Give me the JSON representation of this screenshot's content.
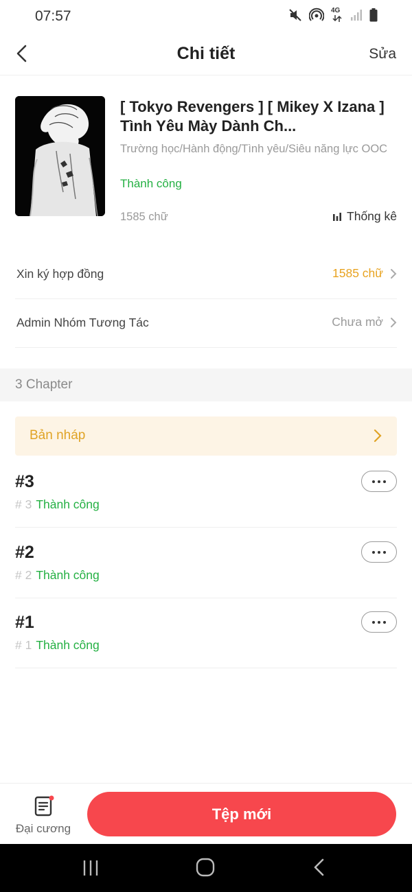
{
  "status_bar": {
    "time": "07:57",
    "icons": [
      "mute-icon",
      "hotspot-icon",
      "network-4g-icon",
      "signal-icon",
      "battery-icon"
    ],
    "network_label": "4G"
  },
  "nav": {
    "title": "Chi tiết",
    "edit_label": "Sửa",
    "back_icon": "chevron-left-icon"
  },
  "book": {
    "title": "[ Tokyo Revengers ] [ Mikey X Izana ] Tình Yêu Mày Dành Ch...",
    "genre": "Trường học/Hành động/Tình yêu/Siêu năng lực OOC",
    "status": "Thành công",
    "word_count": "1585 chữ",
    "stats_label": "Thống kê"
  },
  "rows": [
    {
      "label": "Xin ký hợp đồng",
      "value": "1585 chữ",
      "value_color": "#e8a320"
    },
    {
      "label": "Admin Nhóm Tương Tác",
      "value": "Chưa mở",
      "value_color": "#9a9a9a"
    }
  ],
  "chapter_section": {
    "label": "3 Chapter"
  },
  "draft": {
    "label": "Bản nháp"
  },
  "chapters": [
    {
      "title": "#3",
      "number": "# 3",
      "status": "Thành công"
    },
    {
      "title": "#2",
      "number": "# 2",
      "status": "Thành công"
    },
    {
      "title": "#1",
      "number": "# 1",
      "status": "Thành công"
    }
  ],
  "bottom": {
    "outline_label": "Đại cương",
    "new_file_label": "Tệp mới"
  },
  "colors": {
    "accent_red": "#f7474d",
    "success_green": "#24b043",
    "draft_orange": "#e0a325",
    "draft_bg": "#fdf4e5"
  }
}
